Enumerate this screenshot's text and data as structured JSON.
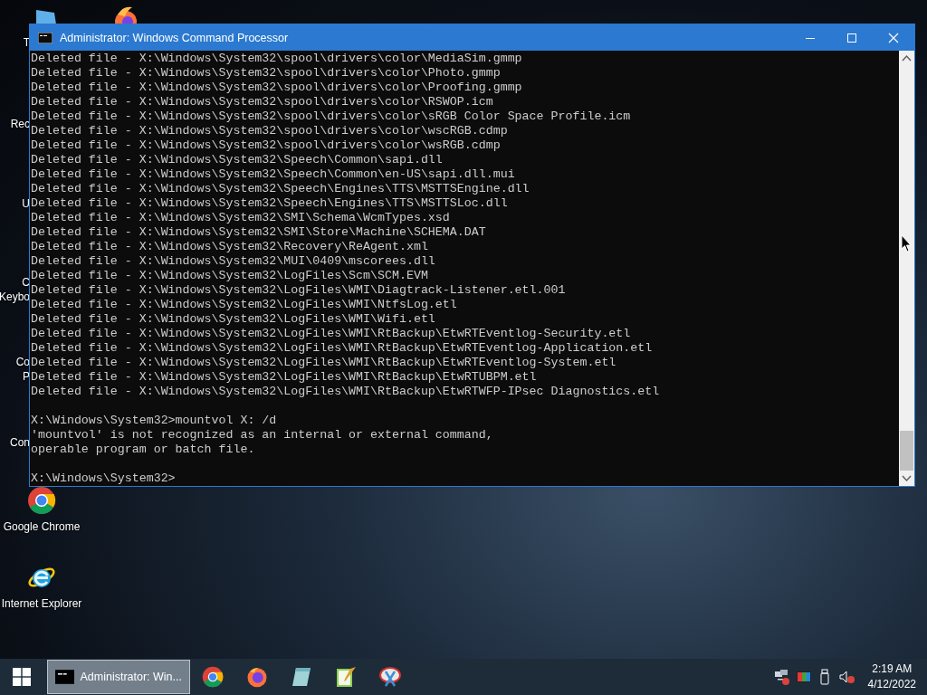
{
  "desktop_fragments": [
    {
      "label": "T",
      "kind": "label"
    },
    {
      "label": "Rec",
      "kind": "label"
    },
    {
      "label": "U",
      "kind": "label"
    },
    {
      "label": "C",
      "kind": "label"
    },
    {
      "label": "Keybo",
      "kind": "label"
    },
    {
      "label": "Co",
      "kind": "label"
    },
    {
      "label": "P",
      "kind": "label"
    },
    {
      "label": "Con",
      "kind": "label"
    }
  ],
  "desktop_icons": [
    {
      "kind": "chrome",
      "label": "Google Chrome"
    },
    {
      "kind": "ie",
      "label": "Internet Explorer"
    }
  ],
  "window": {
    "title": "Administrator: Windows Command Processor",
    "blocks": [
      [
        "Deleted file - X:\\Windows\\System32\\spool\\drivers\\color\\MediaSim.gmmp",
        "Deleted file - X:\\Windows\\System32\\spool\\drivers\\color\\Photo.gmmp",
        "Deleted file - X:\\Windows\\System32\\spool\\drivers\\color\\Proofing.gmmp",
        "Deleted file - X:\\Windows\\System32\\spool\\drivers\\color\\RSWOP.icm",
        "Deleted file - X:\\Windows\\System32\\spool\\drivers\\color\\sRGB Color Space Profile.icm",
        "Deleted file - X:\\Windows\\System32\\spool\\drivers\\color\\wscRGB.cdmp",
        "Deleted file - X:\\Windows\\System32\\spool\\drivers\\color\\wsRGB.cdmp",
        "Deleted file - X:\\Windows\\System32\\Speech\\Common\\sapi.dll",
        "Deleted file - X:\\Windows\\System32\\Speech\\Common\\en-US\\sapi.dll.mui",
        "Deleted file - X:\\Windows\\System32\\Speech\\Engines\\TTS\\MSTTSEngine.dll",
        "Deleted file - X:\\Windows\\System32\\Speech\\Engines\\TTS\\MSTTSLoc.dll",
        "Deleted file - X:\\Windows\\System32\\SMI\\Schema\\WcmTypes.xsd",
        "Deleted file - X:\\Windows\\System32\\SMI\\Store\\Machine\\SCHEMA.DAT",
        "Deleted file - X:\\Windows\\System32\\Recovery\\ReAgent.xml",
        "Deleted file - X:\\Windows\\System32\\MUI\\0409\\mscorees.dll",
        "Deleted file - X:\\Windows\\System32\\LogFiles\\Scm\\SCM.EVM",
        "Deleted file - X:\\Windows\\System32\\LogFiles\\WMI\\Diagtrack-Listener.etl.001",
        "Deleted file - X:\\Windows\\System32\\LogFiles\\WMI\\NtfsLog.etl",
        "Deleted file - X:\\Windows\\System32\\LogFiles\\WMI\\Wifi.etl",
        "Deleted file - X:\\Windows\\System32\\LogFiles\\WMI\\RtBackup\\EtwRTEventlog-Security.etl",
        "Deleted file - X:\\Windows\\System32\\LogFiles\\WMI\\RtBackup\\EtwRTEventlog-Application.etl",
        "Deleted file - X:\\Windows\\System32\\LogFiles\\WMI\\RtBackup\\EtwRTEventlog-System.etl",
        "Deleted file - X:\\Windows\\System32\\LogFiles\\WMI\\RtBackup\\EtwRTUBPM.etl",
        "Deleted file - X:\\Windows\\System32\\LogFiles\\WMI\\RtBackup\\EtwRTWFP-IPsec Diagnostics.etl"
      ],
      [
        "X:\\Windows\\System32>mountvol X: /d",
        "'mountvol' is not recognized as an internal or external command,",
        "operable program or batch file."
      ],
      [
        "X:\\Windows\\System32>"
      ]
    ]
  },
  "taskbar": {
    "items": [
      {
        "kind": "task",
        "label": "Administrator: Win...",
        "selected": true
      },
      {
        "kind": "chrome"
      },
      {
        "kind": "firefox"
      },
      {
        "kind": "notepad"
      },
      {
        "kind": "editor"
      },
      {
        "kind": "snip"
      }
    ],
    "tray": [
      {
        "kind": "network"
      },
      {
        "kind": "display"
      },
      {
        "kind": "usb"
      },
      {
        "kind": "volume"
      }
    ],
    "time": "2:19 AM",
    "date": "4/12/2022"
  }
}
